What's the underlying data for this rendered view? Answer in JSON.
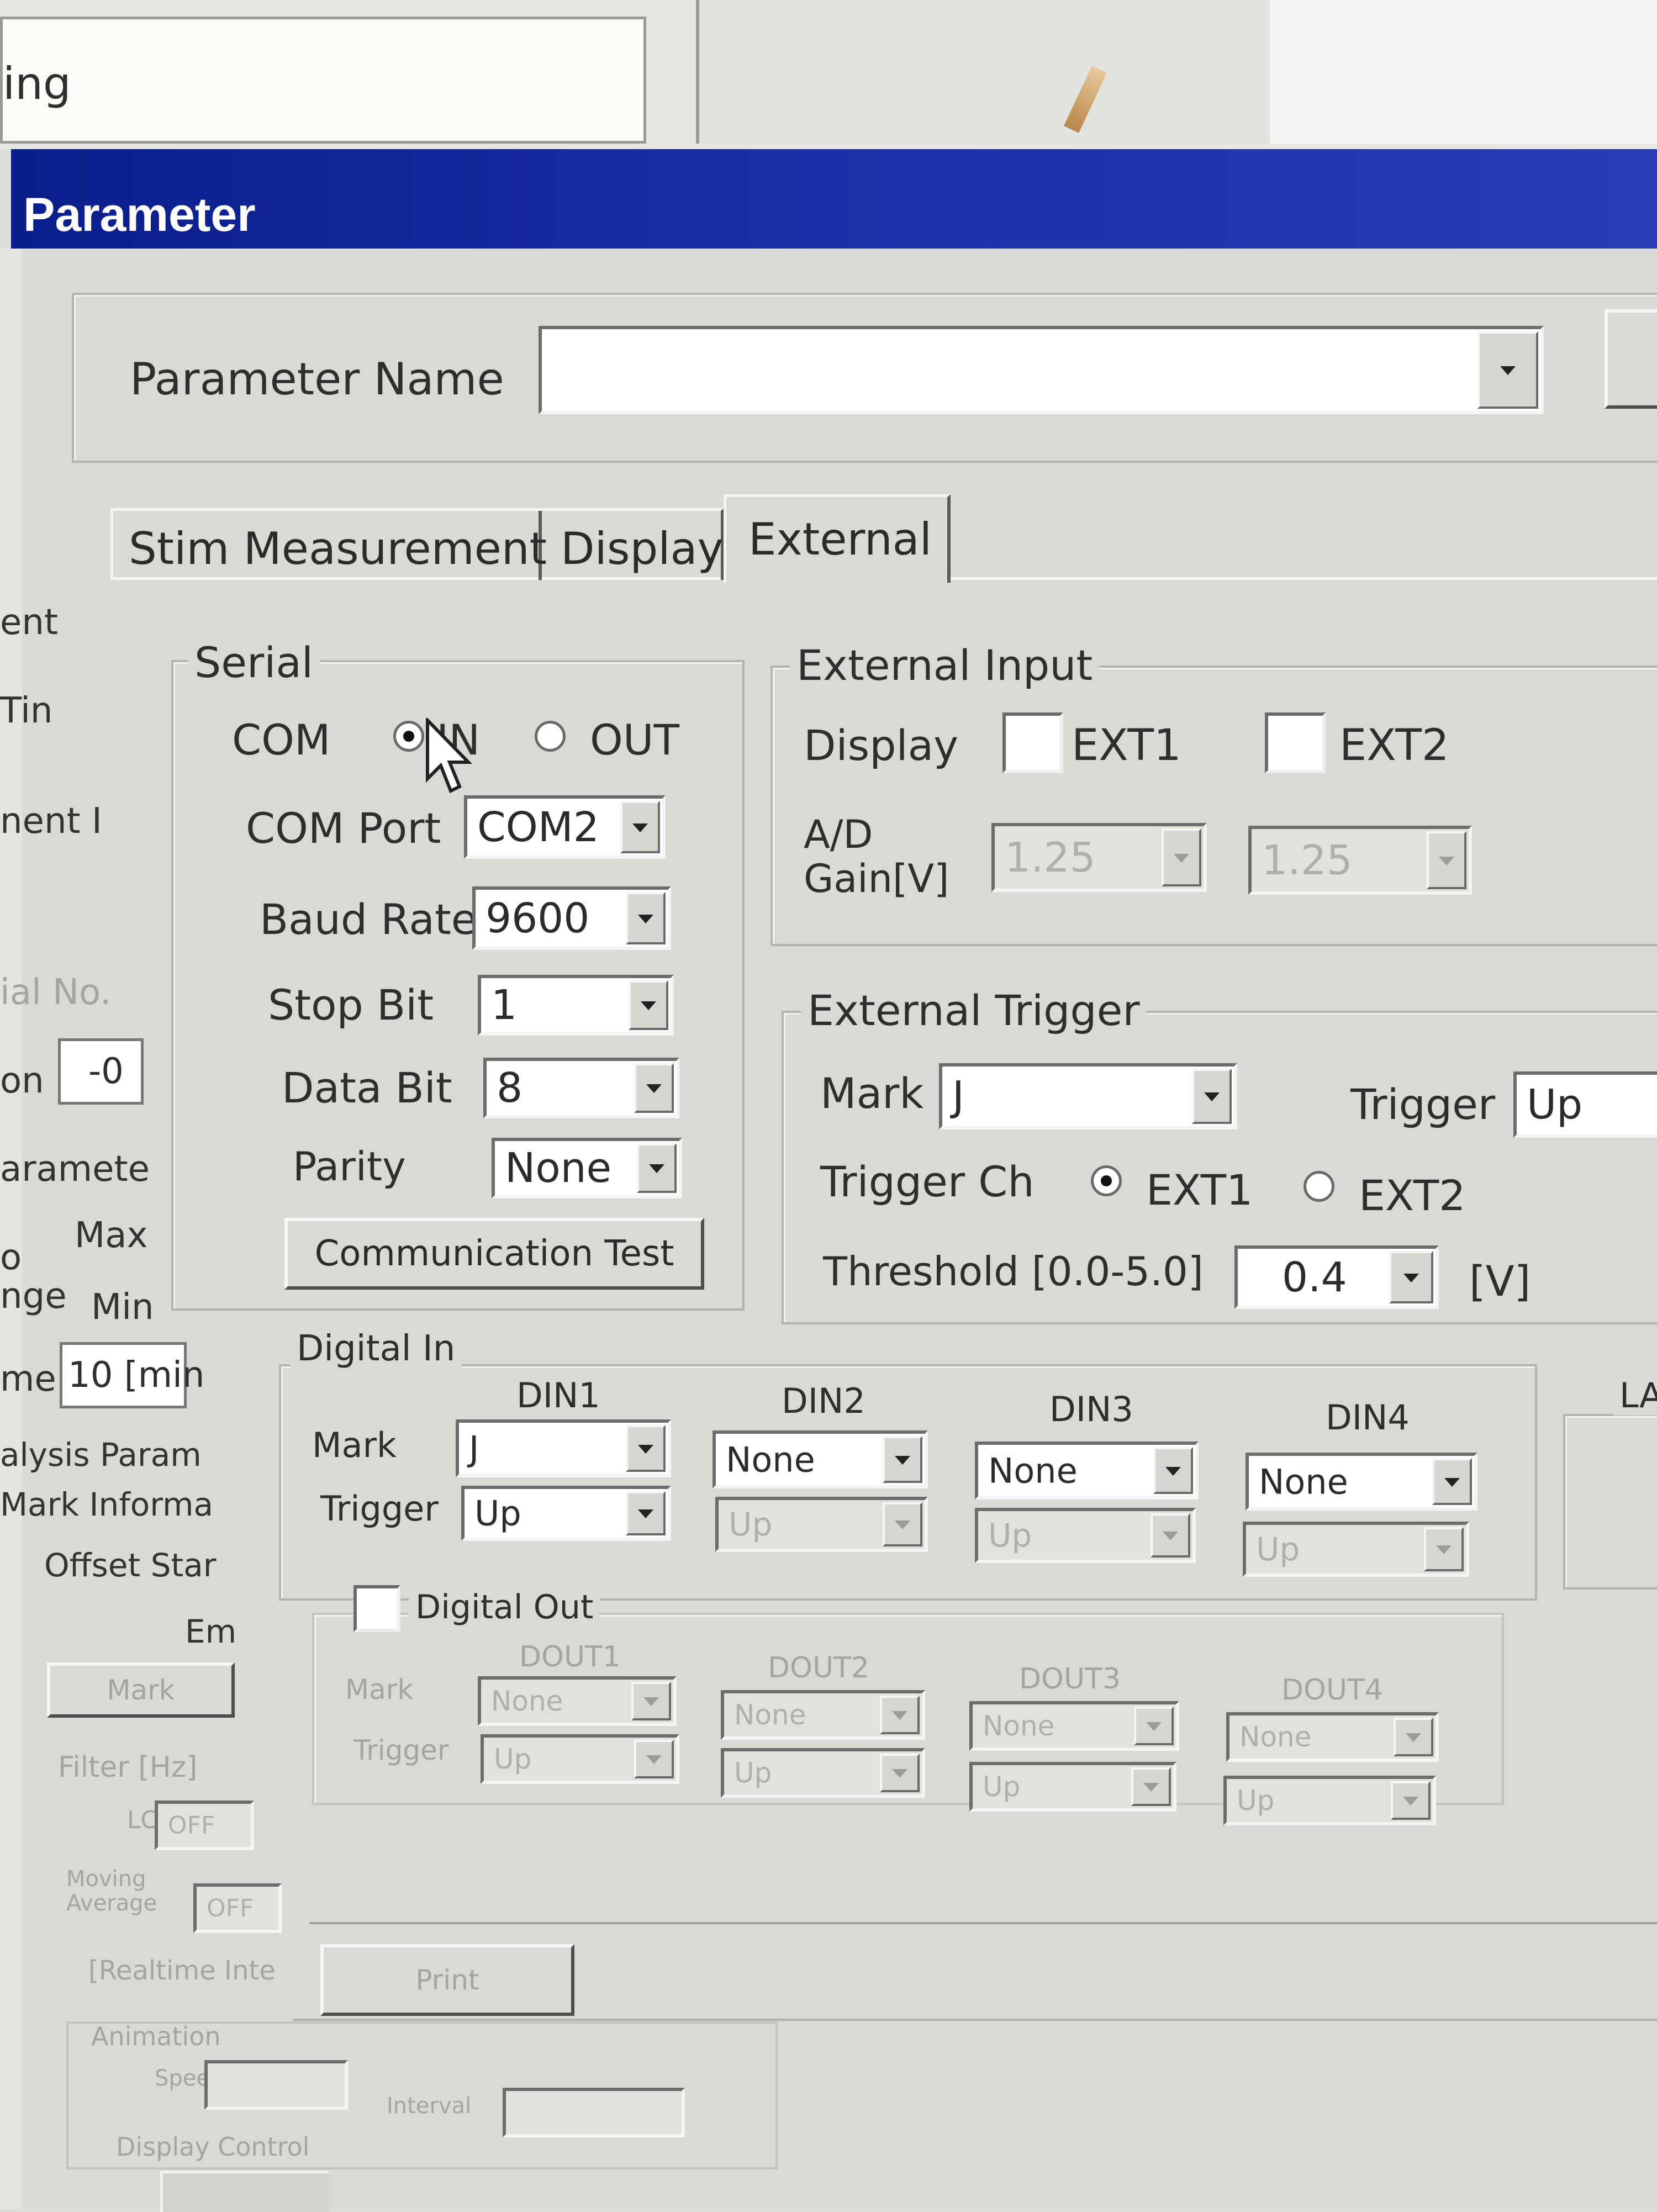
{
  "background_window": {
    "field_text": "ing",
    "left_labels": [
      "ent",
      "Tin",
      "nent I",
      "ial No.",
      "on",
      "-0",
      "aramete",
      "o",
      "Max",
      "nge",
      "Min",
      "me",
      "10 [min",
      "alysis Param",
      "Mark Informa",
      "Offset Star",
      "Em",
      "Mark",
      "Filter [Hz]",
      "LCF",
      "OFF",
      "Moving Average",
      "OFF",
      "[Realtime Inte",
      "Animation",
      "Speed",
      "Interval",
      "Display Control"
    ],
    "print_label": "Print"
  },
  "dialog": {
    "title": "Parameter",
    "parameter_name_label": "Parameter Name",
    "parameter_name_value": "",
    "tabs": [
      {
        "label": "Stim Measurement"
      },
      {
        "label": "Display"
      },
      {
        "label": "External",
        "active": true
      }
    ],
    "serial": {
      "group_label": "Serial",
      "com_label": "COM",
      "in_label": "IN",
      "out_label": "OUT",
      "com_direction": "IN",
      "com_port_label": "COM Port",
      "com_port_value": "COM2",
      "baud_rate_label": "Baud Rate",
      "baud_rate_value": "9600",
      "stop_bit_label": "Stop Bit",
      "stop_bit_value": "1",
      "data_bit_label": "Data Bit",
      "data_bit_value": "8",
      "parity_label": "Parity",
      "parity_value": "None",
      "comm_test_label": "Communication Test"
    },
    "external_input": {
      "group_label": "External Input",
      "display_label": "Display",
      "ext1_label": "EXT1",
      "ext2_label": "EXT2",
      "ad_gain_label_1": "A/D",
      "ad_gain_label_2": "Gain[V]",
      "ad_gain1_value": "1.25",
      "ad_gain2_value": "1.25"
    },
    "external_trigger": {
      "group_label": "External Trigger",
      "mark_label": "Mark",
      "mark_value": "J",
      "trigger_label": "Trigger",
      "trigger_value": "Up",
      "trigger_ch_label": "Trigger Ch",
      "ext1_label": "EXT1",
      "ext2_label": "EXT2",
      "trigger_ch_value": "EXT1",
      "threshold_label": "Threshold [0.0-5.0]",
      "threshold_value": "0.4",
      "threshold_unit": "[V]"
    },
    "digital_in": {
      "group_label": "Digital In",
      "mark_label": "Mark",
      "trigger_label": "Trigger",
      "channels": [
        {
          "name": "DIN1",
          "mark": "J",
          "trigger": "Up",
          "trigger_enabled": true
        },
        {
          "name": "DIN2",
          "mark": "None",
          "trigger": "Up",
          "trigger_enabled": false
        },
        {
          "name": "DIN3",
          "mark": "None",
          "trigger": "Up",
          "trigger_enabled": false
        },
        {
          "name": "DIN4",
          "mark": "None",
          "trigger": "Up",
          "trigger_enabled": false
        }
      ]
    },
    "digital_out": {
      "group_label": "Digital Out",
      "mark_label": "Mark",
      "trigger_label": "Trigger",
      "channels": [
        {
          "name": "DOUT1",
          "mark": "None",
          "trigger": "Up"
        },
        {
          "name": "DOUT2",
          "mark": "None",
          "trigger": "Up"
        },
        {
          "name": "DOUT3",
          "mark": "None",
          "trigger": "Up"
        },
        {
          "name": "DOUT4",
          "mark": "None",
          "trigger": "Up"
        }
      ]
    },
    "edge_label": "LA"
  },
  "colors": {
    "title_bar": "#1d2fa6",
    "dialog_face": "#dadad4",
    "field_bg": "#ffffff"
  }
}
